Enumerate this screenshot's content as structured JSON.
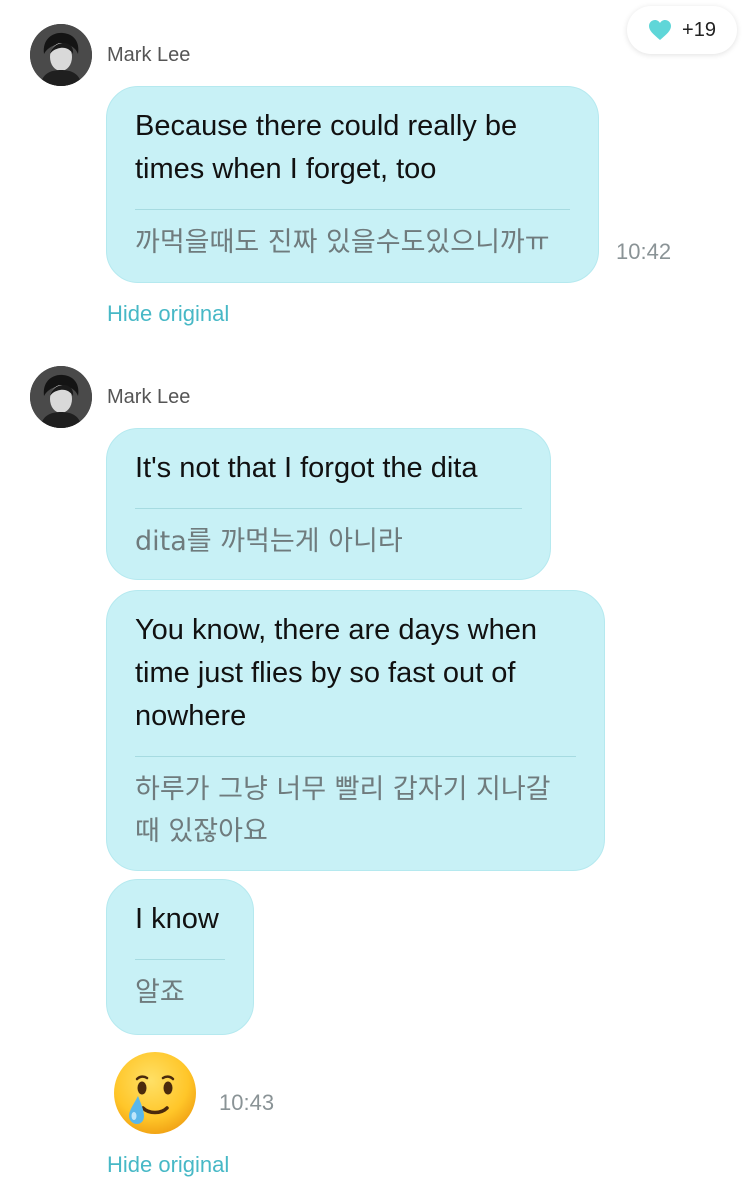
{
  "reaction": {
    "icon": "heart-icon",
    "count": "+19",
    "color": "#5fd6d8"
  },
  "groups": [
    {
      "sender": "Mark Lee",
      "messages": [
        {
          "text": "Because there could really be times when I forget, too",
          "original": "까먹을때도 진짜 있을수도있으니까ㅠ"
        }
      ],
      "time": "10:42",
      "hide_label": "Hide original"
    },
    {
      "sender": "Mark Lee",
      "messages": [
        {
          "text": "It's not that I forgot the dita",
          "original": "dita를 까먹는게 아니라"
        },
        {
          "text": "You know, there are days when time just flies by so fast out of nowhere",
          "original": "하루가 그냥 너무 빨리 갑자기 지나갈 때 있잖아요"
        },
        {
          "text": "I know",
          "original": "알죠"
        }
      ],
      "emoji": "smiling-face-with-tear-icon",
      "time": "10:43",
      "hide_label": "Hide original"
    }
  ],
  "colors": {
    "bubble": "#c8f1f6",
    "link": "#47b8c6"
  }
}
